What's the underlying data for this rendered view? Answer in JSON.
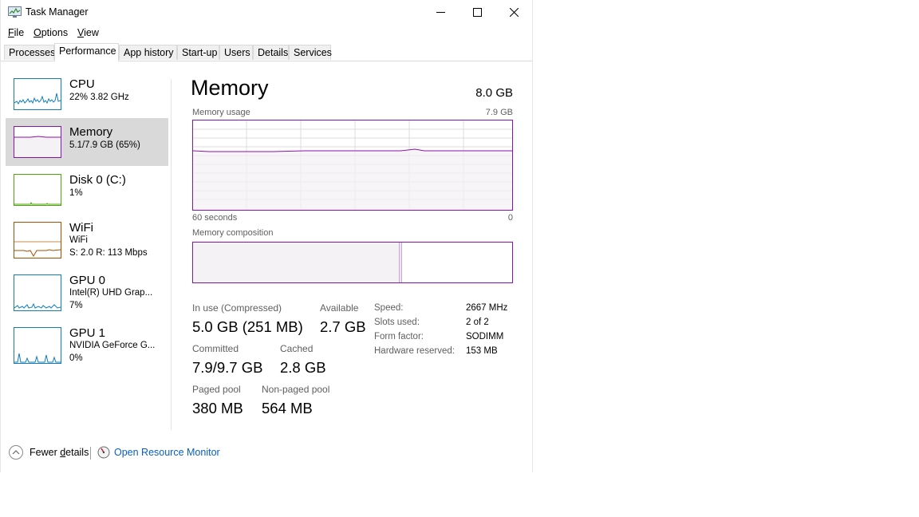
{
  "window": {
    "title": "Task Manager",
    "controls": {
      "minimize": "minimize-icon",
      "maximize": "maximize-icon",
      "close": "close-icon"
    }
  },
  "menu": {
    "file": {
      "accel": "F",
      "rest": "ile"
    },
    "options": {
      "accel": "O",
      "rest": "ptions"
    },
    "view": {
      "accel": "V",
      "rest": "iew"
    }
  },
  "tabs": [
    "Processes",
    "Performance",
    "App history",
    "Start-up",
    "Users",
    "Details",
    "Services"
  ],
  "active_tab": "Performance",
  "sidebar": {
    "items": [
      {
        "name": "CPU",
        "line1": "22%  3.82 GHz",
        "line2": "",
        "color": "#117dbb"
      },
      {
        "name": "Memory",
        "line1": "5.1/7.9 GB (65%)",
        "line2": "",
        "color": "#8b12ae"
      },
      {
        "name": "Disk 0 (C:)",
        "line1": "1%",
        "line2": "",
        "color": "#4da60c"
      },
      {
        "name": "WiFi",
        "line1": "WiFi",
        "line2": "S: 2.0  R: 113 Mbps",
        "color": "#a74f01"
      },
      {
        "name": "GPU 0",
        "line1": "Intel(R) UHD Grap...",
        "line2": "7%",
        "color": "#117dbb"
      },
      {
        "name": "GPU 1",
        "line1": "NVIDIA GeForce G...",
        "line2": "0%",
        "color": "#117dbb"
      }
    ],
    "selected": "Memory"
  },
  "memory": {
    "title": "Memory",
    "total": "8.0 GB",
    "usage_label": "Memory usage",
    "usage_max": "7.9 GB",
    "time_left": "60 seconds",
    "time_right": "0",
    "composition_label": "Memory composition",
    "usage_fraction": 0.65,
    "composition": {
      "in_use_fraction": 0.64,
      "modified_fraction": 0.01
    },
    "stats": {
      "in_use": {
        "label": "In use (Compressed)",
        "value": "5.0 GB (251 MB)"
      },
      "available": {
        "label": "Available",
        "value": "2.7 GB"
      },
      "committed": {
        "label": "Committed",
        "value": "7.9/9.7 GB"
      },
      "cached": {
        "label": "Cached",
        "value": "2.8 GB"
      },
      "paged_pool": {
        "label": "Paged pool",
        "value": "380 MB"
      },
      "non_paged_pool": {
        "label": "Non-paged pool",
        "value": "564 MB"
      }
    },
    "specs": {
      "speed": {
        "label": "Speed:",
        "value": "2667 MHz"
      },
      "slots": {
        "label": "Slots used:",
        "value": "2 of 2"
      },
      "form": {
        "label": "Form factor:",
        "value": "SODIMM"
      },
      "hw_reserved": {
        "label": "Hardware reserved:",
        "value": "153 MB"
      }
    },
    "color": "#8b12ae"
  },
  "footer": {
    "fewer_details": {
      "pre": "Fewer ",
      "accel": "d",
      "post": "etails"
    },
    "resource_monitor": "Open Resource Monitor"
  }
}
